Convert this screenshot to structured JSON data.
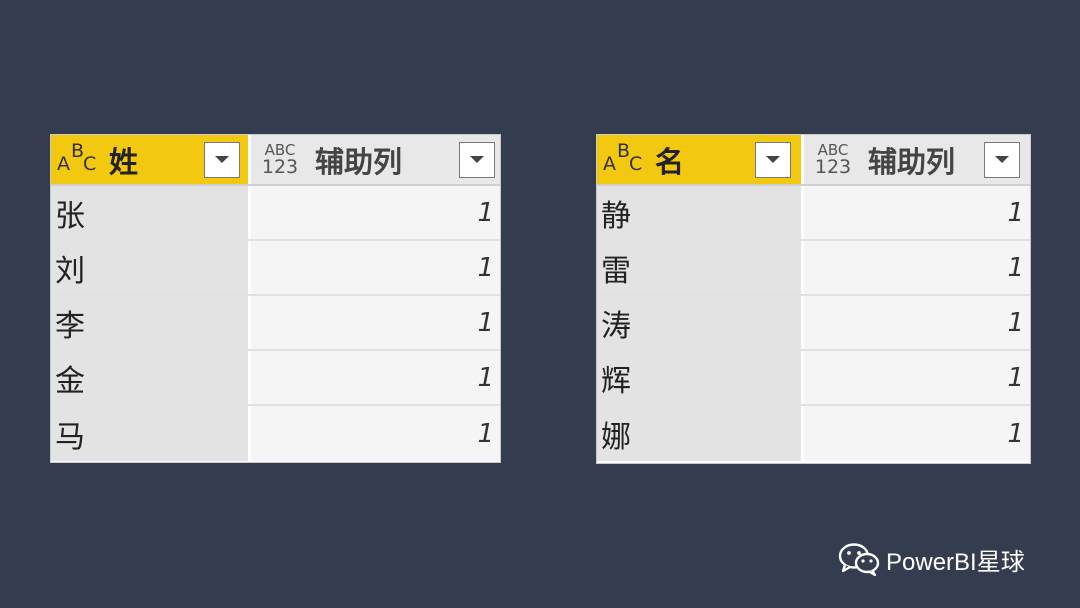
{
  "colors": {
    "background": "#343d4f",
    "text_column_header": "#f2c811",
    "number_column_header": "#e8e8e8"
  },
  "tables": [
    {
      "columns": [
        {
          "type_icon": "abc-type-icon",
          "type_label": "ABC",
          "name": "姓",
          "dropdown_icon": "chevron-down-icon"
        },
        {
          "type_icon": "abc123-type-icon",
          "type_label_top": "ABC",
          "type_label_bottom": "123",
          "name": "辅助列",
          "dropdown_icon": "chevron-down-icon"
        }
      ],
      "rows": [
        {
          "key": "张",
          "value": "1"
        },
        {
          "key": "刘",
          "value": "1"
        },
        {
          "key": "李",
          "value": "1"
        },
        {
          "key": "金",
          "value": "1"
        },
        {
          "key": "马",
          "value": "1"
        }
      ]
    },
    {
      "columns": [
        {
          "type_icon": "abc-type-icon",
          "type_label": "ABC",
          "name": "名",
          "dropdown_icon": "chevron-down-icon"
        },
        {
          "type_icon": "abc123-type-icon",
          "type_label_top": "ABC",
          "type_label_bottom": "123",
          "name": "辅助列",
          "dropdown_icon": "chevron-down-icon"
        }
      ],
      "rows": [
        {
          "key": "静",
          "value": "1"
        },
        {
          "key": "雷",
          "value": "1"
        },
        {
          "key": "涛",
          "value": "1"
        },
        {
          "key": "辉",
          "value": "1"
        },
        {
          "key": "娜",
          "value": "1"
        }
      ]
    }
  ],
  "watermark": {
    "icon": "wechat-icon",
    "text": "PowerBI星球"
  }
}
